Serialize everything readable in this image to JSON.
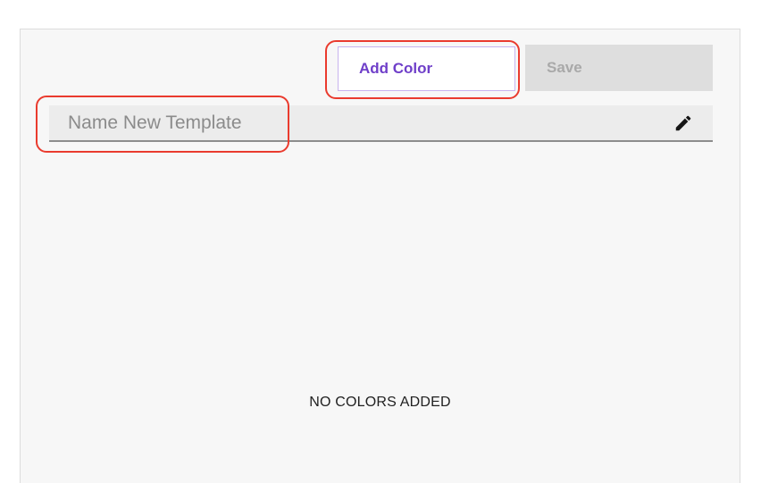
{
  "toolbar": {
    "add_color_label": "Add Color",
    "save_label": "Save"
  },
  "template_name": {
    "value": "",
    "placeholder": "Name New Template",
    "edit_icon": "pencil-icon"
  },
  "empty_state": {
    "message": "NO COLORS ADDED"
  },
  "colors": {
    "accent": "#6f3fc9",
    "highlight": "#ea3b2e",
    "disabled_bg": "#dedede",
    "disabled_text": "#a9a9a9"
  }
}
